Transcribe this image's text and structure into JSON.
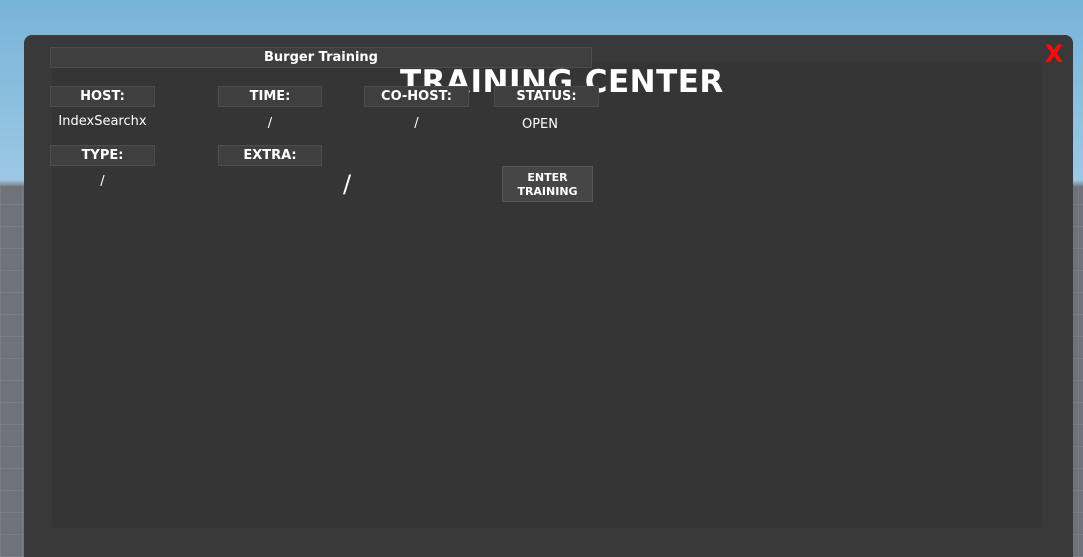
{
  "window": {
    "title": "Burger Training",
    "heading": "TRAINING CENTER",
    "close_label": "X"
  },
  "fields": {
    "host": {
      "label": "HOST:",
      "value": "IndexSearchx"
    },
    "time": {
      "label": "TIME:",
      "value": "/"
    },
    "cohost": {
      "label": "CO-HOST:",
      "value": "/"
    },
    "status": {
      "label": "STATUS:",
      "value": "OPEN"
    },
    "type": {
      "label": "TYPE:",
      "value": "/"
    },
    "extra": {
      "label": "EXTRA:",
      "value": "/"
    }
  },
  "actions": {
    "enter_line1": "ENTER",
    "enter_line2": "TRAINING"
  },
  "colors": {
    "panel": "#393939",
    "close": "#ff0a0a"
  }
}
